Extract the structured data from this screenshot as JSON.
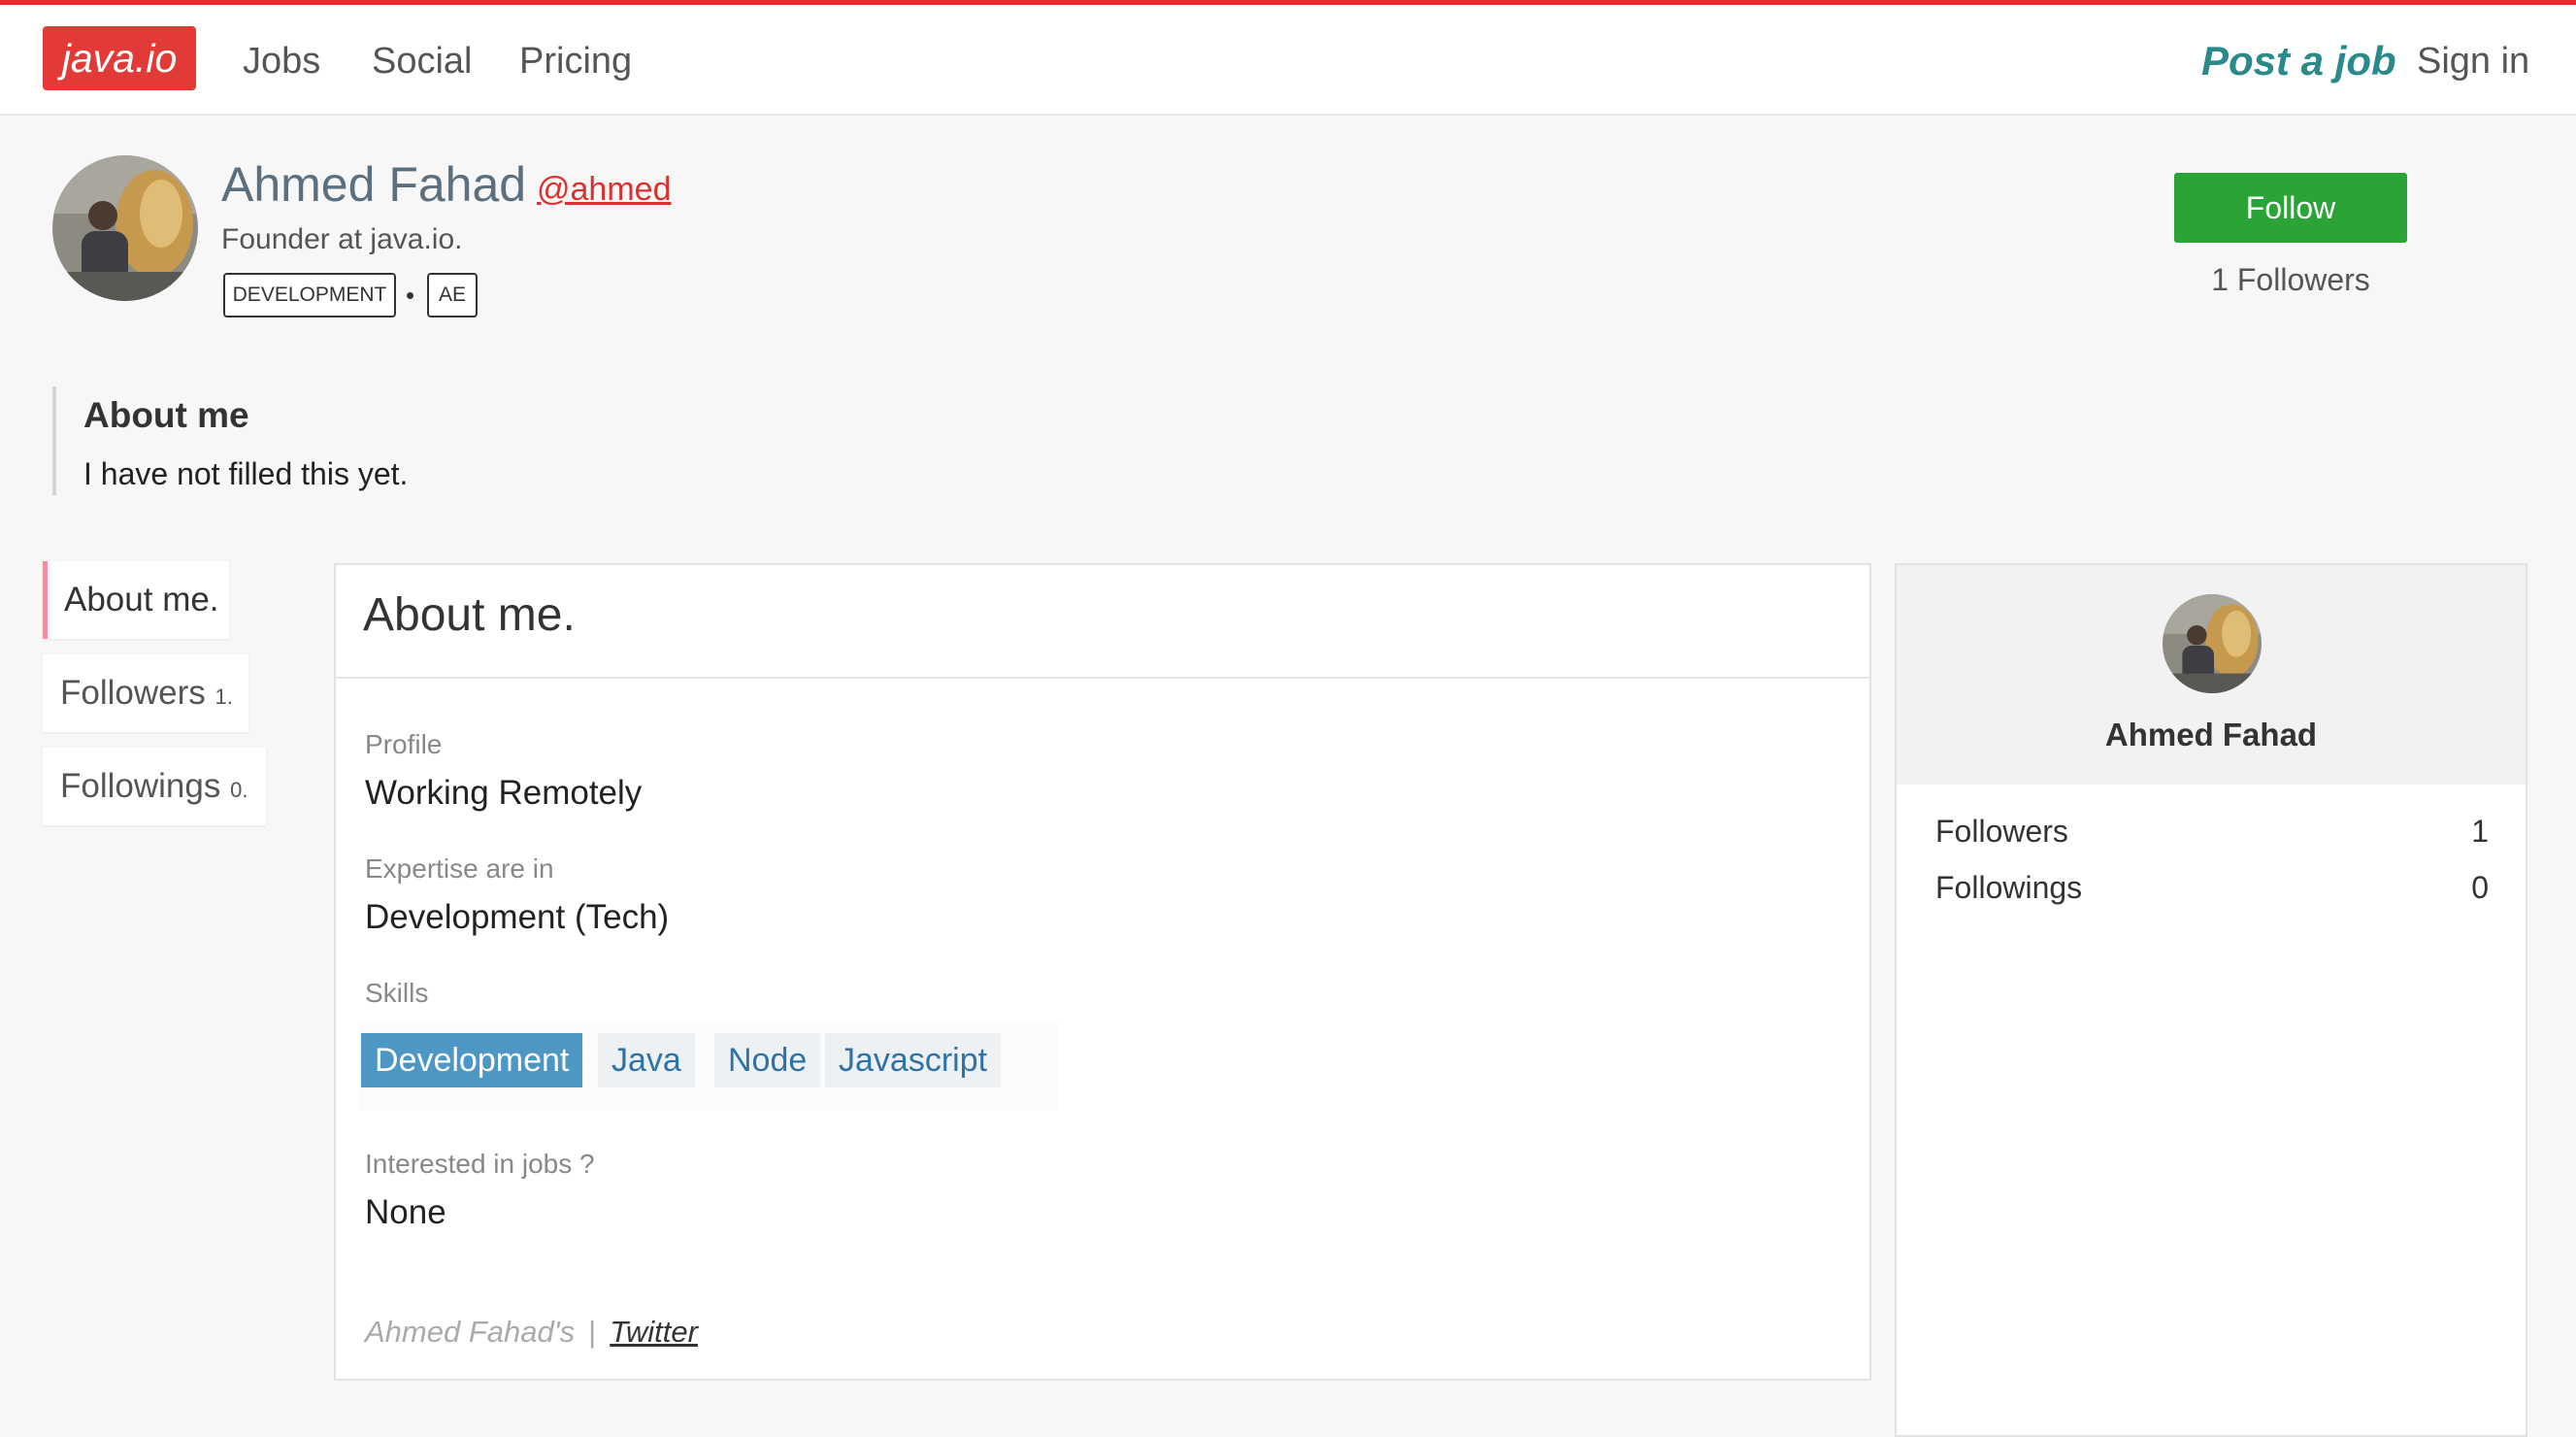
{
  "nav": {
    "logo": "java.io",
    "links": [
      "Jobs",
      "Social",
      "Pricing"
    ],
    "post_job": "Post a job",
    "sign_in": "Sign in"
  },
  "profile": {
    "name": "Ahmed Fahad",
    "handle": "@ahmed",
    "tagline": "Founder at java.io.",
    "tags": [
      "DEVELOPMENT",
      "AE"
    ],
    "tag_separator": "•",
    "follow_label": "Follow",
    "followers_text": "1 Followers"
  },
  "about": {
    "title": "About me",
    "text": "I have not filled this yet."
  },
  "side_tabs": [
    {
      "label": "About me.",
      "count": ""
    },
    {
      "label": "Followers",
      "count": "1."
    },
    {
      "label": "Followings",
      "count": "0."
    }
  ],
  "details": {
    "title": "About me.",
    "profile_label": "Profile",
    "profile_value": "Working Remotely",
    "expertise_label": "Expertise are in",
    "expertise_value": "Development (Tech)",
    "skills_label": "Skills",
    "skills": [
      "Development",
      "Java",
      "Node",
      "Javascript"
    ],
    "jobs_label": "Interested in jobs ?",
    "jobs_value": "None",
    "footer_owner": "Ahmed Fahad's",
    "footer_separator": "|",
    "footer_link": "Twitter"
  },
  "summary": {
    "name": "Ahmed Fahad",
    "followers_label": "Followers",
    "followers_value": "1",
    "followings_label": "Followings",
    "followings_value": "0"
  },
  "colors": {
    "brand": "#e23b37",
    "follow": "#2aa436",
    "post_job": "#2a8a89",
    "skill_primary": "#4d97c5",
    "link": "#2f73a6"
  }
}
